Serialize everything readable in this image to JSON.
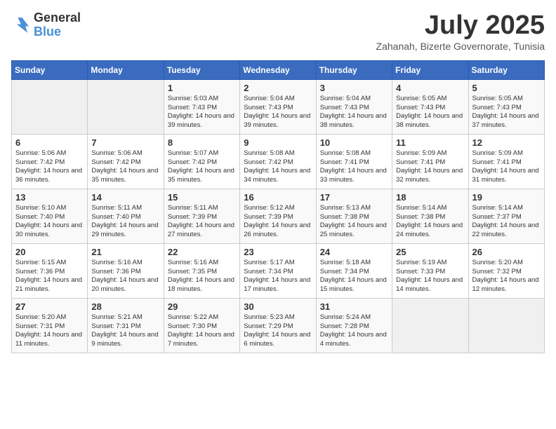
{
  "header": {
    "logo_line1": "General",
    "logo_line2": "Blue",
    "month_title": "July 2025",
    "location": "Zahanah, Bizerte Governorate, Tunisia"
  },
  "days_of_week": [
    "Sunday",
    "Monday",
    "Tuesday",
    "Wednesday",
    "Thursday",
    "Friday",
    "Saturday"
  ],
  "weeks": [
    [
      {
        "day": "",
        "data": ""
      },
      {
        "day": "",
        "data": ""
      },
      {
        "day": "1",
        "data": "Sunrise: 5:03 AM\nSunset: 7:43 PM\nDaylight: 14 hours and 39 minutes."
      },
      {
        "day": "2",
        "data": "Sunrise: 5:04 AM\nSunset: 7:43 PM\nDaylight: 14 hours and 39 minutes."
      },
      {
        "day": "3",
        "data": "Sunrise: 5:04 AM\nSunset: 7:43 PM\nDaylight: 14 hours and 38 minutes."
      },
      {
        "day": "4",
        "data": "Sunrise: 5:05 AM\nSunset: 7:43 PM\nDaylight: 14 hours and 38 minutes."
      },
      {
        "day": "5",
        "data": "Sunrise: 5:05 AM\nSunset: 7:43 PM\nDaylight: 14 hours and 37 minutes."
      }
    ],
    [
      {
        "day": "6",
        "data": "Sunrise: 5:06 AM\nSunset: 7:42 PM\nDaylight: 14 hours and 36 minutes."
      },
      {
        "day": "7",
        "data": "Sunrise: 5:06 AM\nSunset: 7:42 PM\nDaylight: 14 hours and 35 minutes."
      },
      {
        "day": "8",
        "data": "Sunrise: 5:07 AM\nSunset: 7:42 PM\nDaylight: 14 hours and 35 minutes."
      },
      {
        "day": "9",
        "data": "Sunrise: 5:08 AM\nSunset: 7:42 PM\nDaylight: 14 hours and 34 minutes."
      },
      {
        "day": "10",
        "data": "Sunrise: 5:08 AM\nSunset: 7:41 PM\nDaylight: 14 hours and 33 minutes."
      },
      {
        "day": "11",
        "data": "Sunrise: 5:09 AM\nSunset: 7:41 PM\nDaylight: 14 hours and 32 minutes."
      },
      {
        "day": "12",
        "data": "Sunrise: 5:09 AM\nSunset: 7:41 PM\nDaylight: 14 hours and 31 minutes."
      }
    ],
    [
      {
        "day": "13",
        "data": "Sunrise: 5:10 AM\nSunset: 7:40 PM\nDaylight: 14 hours and 30 minutes."
      },
      {
        "day": "14",
        "data": "Sunrise: 5:11 AM\nSunset: 7:40 PM\nDaylight: 14 hours and 29 minutes."
      },
      {
        "day": "15",
        "data": "Sunrise: 5:11 AM\nSunset: 7:39 PM\nDaylight: 14 hours and 27 minutes."
      },
      {
        "day": "16",
        "data": "Sunrise: 5:12 AM\nSunset: 7:39 PM\nDaylight: 14 hours and 26 minutes."
      },
      {
        "day": "17",
        "data": "Sunrise: 5:13 AM\nSunset: 7:38 PM\nDaylight: 14 hours and 25 minutes."
      },
      {
        "day": "18",
        "data": "Sunrise: 5:14 AM\nSunset: 7:38 PM\nDaylight: 14 hours and 24 minutes."
      },
      {
        "day": "19",
        "data": "Sunrise: 5:14 AM\nSunset: 7:37 PM\nDaylight: 14 hours and 22 minutes."
      }
    ],
    [
      {
        "day": "20",
        "data": "Sunrise: 5:15 AM\nSunset: 7:36 PM\nDaylight: 14 hours and 21 minutes."
      },
      {
        "day": "21",
        "data": "Sunrise: 5:16 AM\nSunset: 7:36 PM\nDaylight: 14 hours and 20 minutes."
      },
      {
        "day": "22",
        "data": "Sunrise: 5:16 AM\nSunset: 7:35 PM\nDaylight: 14 hours and 18 minutes."
      },
      {
        "day": "23",
        "data": "Sunrise: 5:17 AM\nSunset: 7:34 PM\nDaylight: 14 hours and 17 minutes."
      },
      {
        "day": "24",
        "data": "Sunrise: 5:18 AM\nSunset: 7:34 PM\nDaylight: 14 hours and 15 minutes."
      },
      {
        "day": "25",
        "data": "Sunrise: 5:19 AM\nSunset: 7:33 PM\nDaylight: 14 hours and 14 minutes."
      },
      {
        "day": "26",
        "data": "Sunrise: 5:20 AM\nSunset: 7:32 PM\nDaylight: 14 hours and 12 minutes."
      }
    ],
    [
      {
        "day": "27",
        "data": "Sunrise: 5:20 AM\nSunset: 7:31 PM\nDaylight: 14 hours and 11 minutes."
      },
      {
        "day": "28",
        "data": "Sunrise: 5:21 AM\nSunset: 7:31 PM\nDaylight: 14 hours and 9 minutes."
      },
      {
        "day": "29",
        "data": "Sunrise: 5:22 AM\nSunset: 7:30 PM\nDaylight: 14 hours and 7 minutes."
      },
      {
        "day": "30",
        "data": "Sunrise: 5:23 AM\nSunset: 7:29 PM\nDaylight: 14 hours and 6 minutes."
      },
      {
        "day": "31",
        "data": "Sunrise: 5:24 AM\nSunset: 7:28 PM\nDaylight: 14 hours and 4 minutes."
      },
      {
        "day": "",
        "data": ""
      },
      {
        "day": "",
        "data": ""
      }
    ]
  ]
}
